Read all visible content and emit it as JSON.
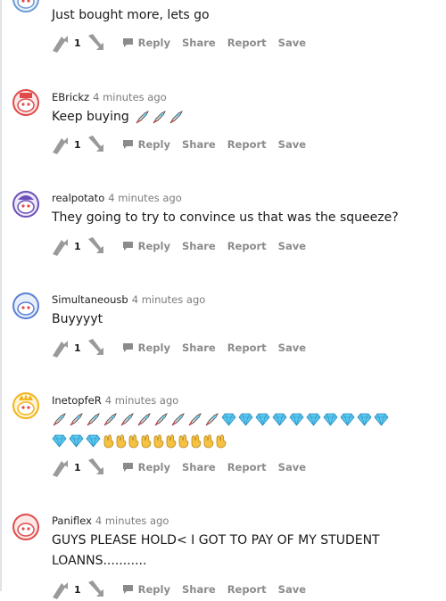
{
  "comments": [
    {
      "username": "",
      "timestamp": "",
      "body": "Just bought more, lets go",
      "score": "1",
      "actions": {
        "reply": "Reply",
        "share": "Share",
        "report": "Report",
        "save": "Save"
      },
      "avatar_color": "#6a9bd8"
    },
    {
      "username": "EBrickz",
      "timestamp": "4 minutes ago",
      "body": "Keep buying",
      "body_emoji": [
        "rocket",
        "rocket",
        "rocket"
      ],
      "score": "1",
      "actions": {
        "reply": "Reply",
        "share": "Share",
        "report": "Report",
        "save": "Save"
      },
      "avatar_color": "#e04a4a"
    },
    {
      "username": "realpotato",
      "timestamp": "4 minutes ago",
      "body": "They going to try to convince us that was the squeeze?",
      "score": "1",
      "actions": {
        "reply": "Reply",
        "share": "Share",
        "report": "Report",
        "save": "Save"
      },
      "avatar_color": "#6b4fb8"
    },
    {
      "username": "Simultaneousb",
      "timestamp": "4 minutes ago",
      "body": "Buyyyyt",
      "score": "1",
      "actions": {
        "reply": "Reply",
        "share": "Share",
        "report": "Report",
        "save": "Save"
      },
      "avatar_color": "#5a7fd6"
    },
    {
      "username": "InetopfeR",
      "timestamp": "4 minutes ago",
      "body": "",
      "emoji_line1": [
        "rocket",
        "rocket",
        "rocket",
        "rocket",
        "rocket",
        "rocket",
        "rocket",
        "rocket",
        "rocket",
        "rocket",
        "diamond",
        "diamond",
        "diamond",
        "diamond",
        "diamond",
        "diamond",
        "diamond",
        "diamond",
        "diamond",
        "diamond"
      ],
      "emoji_line2": [
        "diamond",
        "diamond",
        "diamond",
        "hand",
        "hand",
        "hand",
        "hand",
        "hand",
        "hand",
        "hand",
        "hand",
        "hand",
        "hand"
      ],
      "score": "1",
      "actions": {
        "reply": "Reply",
        "share": "Share",
        "report": "Report",
        "save": "Save"
      },
      "avatar_color": "#f3b31a"
    },
    {
      "username": "Paniflex",
      "timestamp": "4 minutes ago",
      "body_line1": "GUYS PLEASE HOLD< I GOT TO PAY OF MY STUDENT",
      "body_line2": "LOANNS...........",
      "score": "1",
      "actions": {
        "reply": "Reply",
        "share": "Share",
        "report": "Report",
        "save": "Save"
      },
      "avatar_color": "#e04a4a"
    }
  ],
  "colors": {
    "action_gray": "#8b8b8b",
    "timestamp_gray": "#7c7c7c",
    "diamond": "#5bc8f0",
    "hand": "#f5c242",
    "rocket": "#e04a4a"
  },
  "icons": [
    "snoo-avatar-icon",
    "upvote-arrow-icon",
    "downvote-arrow-icon",
    "reply-bubble-icon",
    "rocket-emoji-icon",
    "gem-emoji-icon",
    "raised-hands-emoji-icon"
  ]
}
